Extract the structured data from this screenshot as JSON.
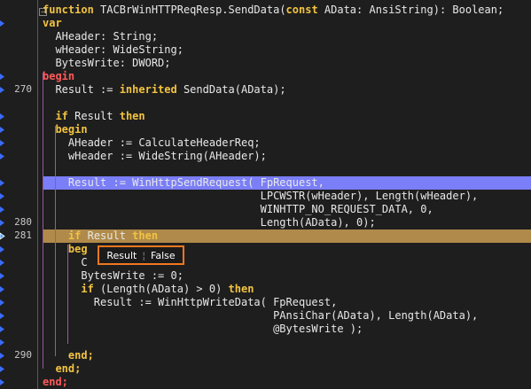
{
  "editor": {
    "line_numbers": [
      {
        "label": "270",
        "row": 6
      },
      {
        "label": "280",
        "row": 16
      },
      {
        "label": "281",
        "row": 17
      },
      {
        "label": "290",
        "row": 26
      }
    ],
    "lines": [
      [
        {
          "t": "function ",
          "c": "kw"
        },
        {
          "t": "TACBrWinHTTPReqResp.SendData(",
          "c": ""
        },
        {
          "t": "const ",
          "c": "kw"
        },
        {
          "t": "AData: AnsiString): Boolean;",
          "c": ""
        }
      ],
      [
        {
          "t": "var",
          "c": "kw"
        }
      ],
      [
        {
          "t": "  AHeader: String;",
          "c": ""
        }
      ],
      [
        {
          "t": "  wHeader: WideString;",
          "c": ""
        }
      ],
      [
        {
          "t": "  BytesWrite: DWORD;",
          "c": ""
        }
      ],
      [
        {
          "t": "begin",
          "c": "red"
        }
      ],
      [
        {
          "t": "  Result := ",
          "c": ""
        },
        {
          "t": "inherited ",
          "c": "kw"
        },
        {
          "t": "SendData(AData);",
          "c": ""
        }
      ],
      [
        {
          "t": "",
          "c": ""
        }
      ],
      [
        {
          "t": "  ",
          "c": ""
        },
        {
          "t": "if ",
          "c": "kw"
        },
        {
          "t": "Result ",
          "c": ""
        },
        {
          "t": "then",
          "c": "kw"
        }
      ],
      [
        {
          "t": "  ",
          "c": ""
        },
        {
          "t": "begin",
          "c": "kw"
        }
      ],
      [
        {
          "t": "    AHeader := CalculateHeaderReq;",
          "c": ""
        }
      ],
      [
        {
          "t": "    wHeader := WideString(AHeader);",
          "c": ""
        }
      ],
      [
        {
          "t": "",
          "c": ""
        }
      ],
      [
        {
          "t": "    Result := WinHttpSendRequest( FpRequest,",
          "c": ""
        }
      ],
      [
        {
          "t": "                                  LPCWSTR(wHeader), Length(wHeader),",
          "c": ""
        }
      ],
      [
        {
          "t": "                                  WINHTTP_NO_REQUEST_DATA, 0,",
          "c": ""
        }
      ],
      [
        {
          "t": "                                  Length(AData), 0);",
          "c": ""
        }
      ],
      [
        {
          "t": "    ",
          "c": ""
        },
        {
          "t": "if ",
          "c": "kw"
        },
        {
          "t": "Result ",
          "c": ""
        },
        {
          "t": "then",
          "c": "kw"
        }
      ],
      [
        {
          "t": "    ",
          "c": ""
        },
        {
          "t": "beg",
          "c": "kw"
        }
      ],
      [
        {
          "t": "      C",
          "c": ""
        }
      ],
      [
        {
          "t": "      BytesWrite := 0;",
          "c": ""
        }
      ],
      [
        {
          "t": "      ",
          "c": ""
        },
        {
          "t": "if ",
          "c": "kw"
        },
        {
          "t": "(Length(AData) > 0) ",
          "c": ""
        },
        {
          "t": "then",
          "c": "kw"
        }
      ],
      [
        {
          "t": "        Result := WinHttpWriteData( FpRequest,",
          "c": ""
        }
      ],
      [
        {
          "t": "                                    PAnsiChar(AData), Length(AData),",
          "c": ""
        }
      ],
      [
        {
          "t": "                                    @BytesWrite );",
          "c": ""
        }
      ],
      [
        {
          "t": "",
          "c": ""
        }
      ],
      [
        {
          "t": "    ",
          "c": ""
        },
        {
          "t": "end;",
          "c": "kw"
        }
      ],
      [
        {
          "t": "  ",
          "c": ""
        },
        {
          "t": "end;",
          "c": "kw"
        }
      ],
      [
        {
          "t": "end;",
          "c": "red"
        }
      ]
    ]
  },
  "tooltip": {
    "name": "Result",
    "value": "False"
  },
  "colors": {
    "keyword": "#f2c341",
    "begin_end_red": "#ff5a5a",
    "exec_line": "#7a7ef7",
    "current_line": "#b08a4a",
    "tooltip_border": "#f07820"
  }
}
